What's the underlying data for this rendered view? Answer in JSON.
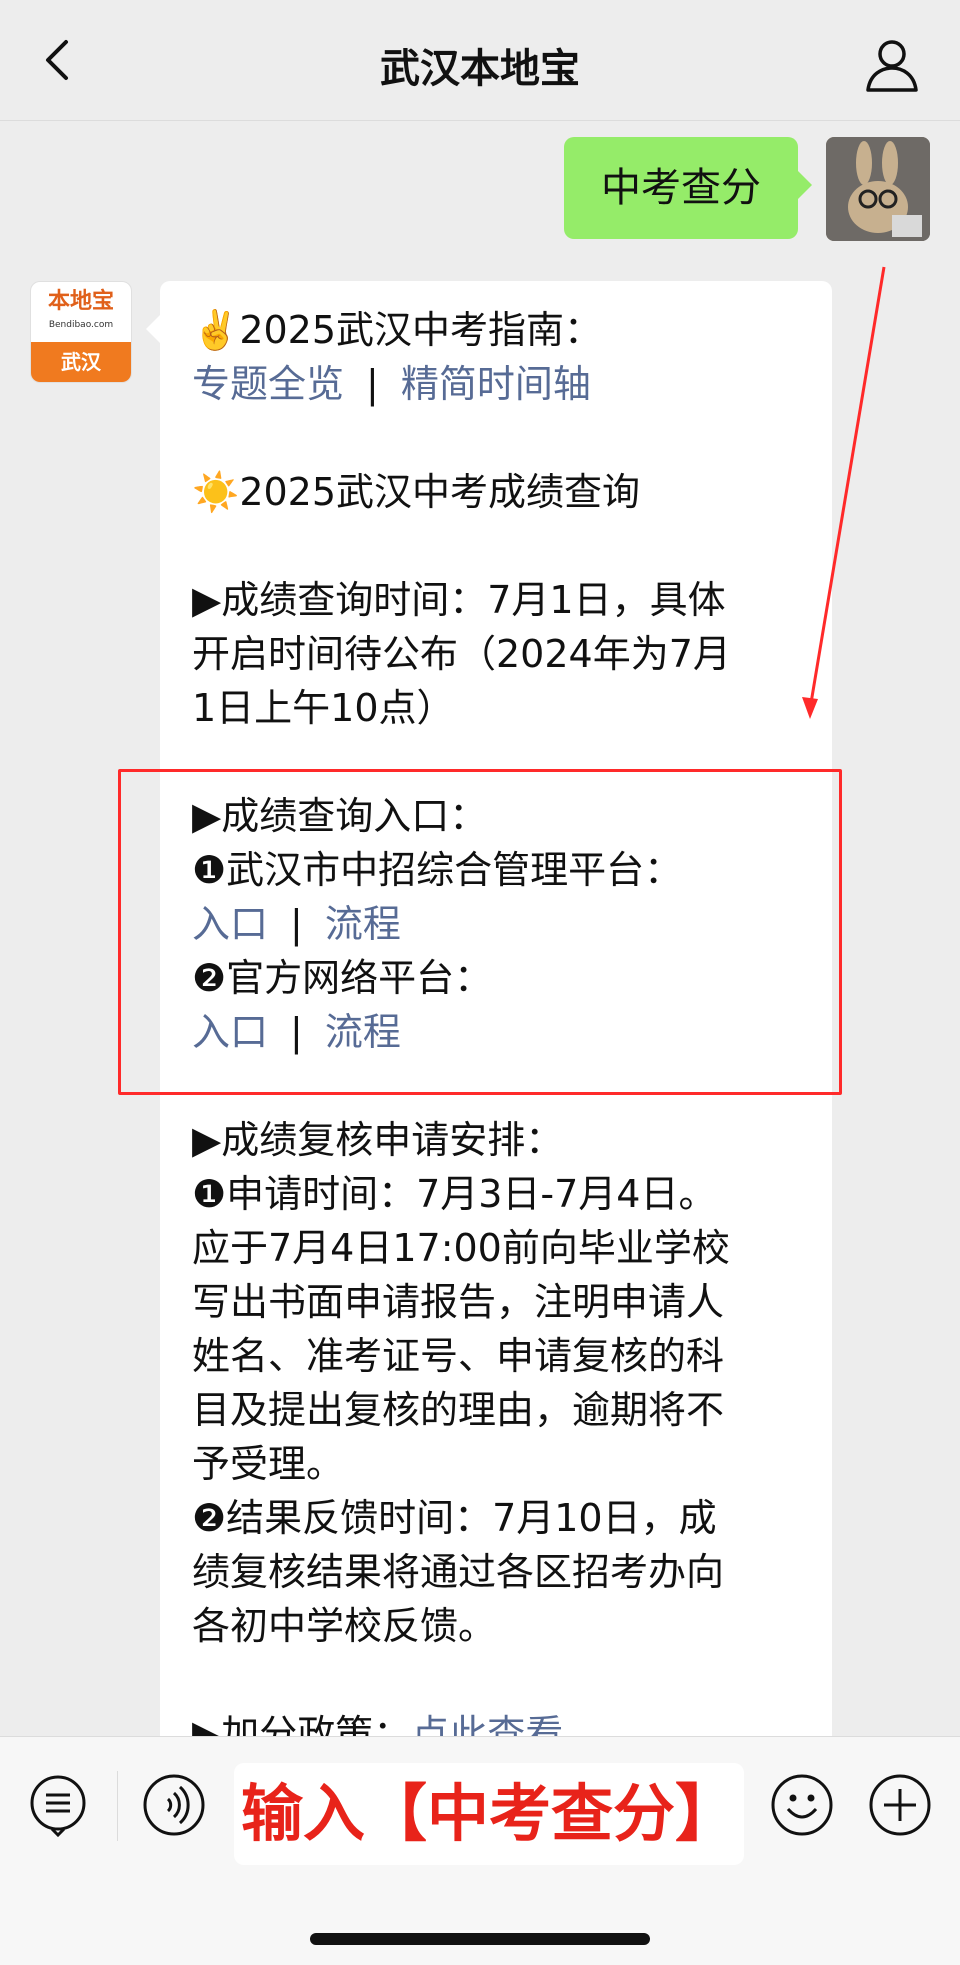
{
  "header": {
    "title": "武汉本地宝"
  },
  "messages": {
    "user_text": "中考查分",
    "bot_avatar": {
      "brand": "本地宝",
      "site": "Bendibao.com",
      "city": "武汉"
    },
    "bot_lines": [
      {
        "type": "text",
        "text": "✌️2025武汉中考指南："
      },
      {
        "type": "links",
        "items": [
          "专题全览",
          "精简时间轴"
        ]
      },
      {
        "type": "blank"
      },
      {
        "type": "text",
        "text": "☀️2025武汉中考成绩查询"
      },
      {
        "type": "blank"
      },
      {
        "type": "text",
        "text": "▶成绩查询时间：7月1日，具体"
      },
      {
        "type": "text",
        "text": "开启时间待公布（2024年为7月"
      },
      {
        "type": "text",
        "text": "1日上午10点）"
      },
      {
        "type": "blank"
      },
      {
        "type": "text",
        "text": "▶成绩查询入口："
      },
      {
        "type": "text",
        "text": "❶武汉市中招综合管理平台："
      },
      {
        "type": "links",
        "items": [
          "入口",
          "流程"
        ]
      },
      {
        "type": "text",
        "text": "❷官方网络平台："
      },
      {
        "type": "links",
        "items": [
          "入口",
          "流程"
        ]
      },
      {
        "type": "blank"
      },
      {
        "type": "text",
        "text": "▶成绩复核申请安排："
      },
      {
        "type": "text",
        "text": "❶申请时间：7月3日-7月4日。"
      },
      {
        "type": "text",
        "text": "应于7月4日17:00前向毕业学校"
      },
      {
        "type": "text",
        "text": "写出书面申请报告，注明申请人"
      },
      {
        "type": "text",
        "text": "姓名、准考证号、申请复核的科"
      },
      {
        "type": "text",
        "text": "目及提出复核的理由，逾期将不"
      },
      {
        "type": "text",
        "text": "予受理。"
      },
      {
        "type": "text",
        "text": "❷结果反馈时间：7月10日，成"
      },
      {
        "type": "text",
        "text": "绩复核结果将通过各区招考办向"
      },
      {
        "type": "text",
        "text": "各初中学校反馈。"
      },
      {
        "type": "blank"
      },
      {
        "type": "mixed",
        "text": "▶加分政策：",
        "link": "点此查看"
      }
    ]
  },
  "footer": {
    "input_text": "输入【中考查分】"
  },
  "colors": {
    "highlight": "#ff2a2a",
    "link": "#576b95",
    "green_bubble": "#95ec69"
  }
}
